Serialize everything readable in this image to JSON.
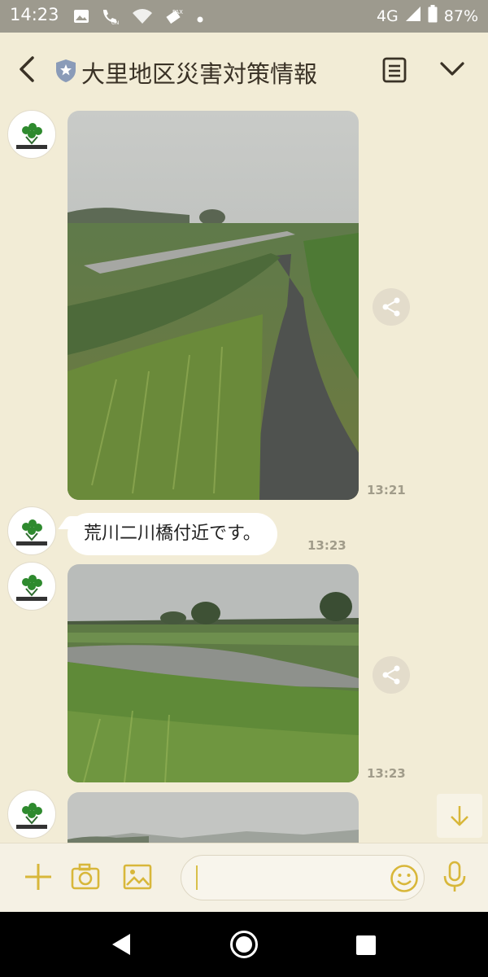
{
  "status_bar": {
    "time": "14:23",
    "network": "4G",
    "battery": "87%",
    "icons": [
      "image-icon",
      "call-volte-icon",
      "wifi-icon",
      "fax-icon",
      "dot-icon",
      "signal-icon",
      "battery-icon"
    ]
  },
  "header": {
    "title": "大里地区災害対策情報",
    "icons": [
      "back-arrow-icon",
      "official-shield-icon",
      "notes-menu-icon",
      "chevron-down-icon"
    ]
  },
  "messages": [
    {
      "type": "image",
      "time": "13:21",
      "scene": "rain-soaked embankment path beside river"
    },
    {
      "type": "text",
      "text": "荒川二川橋付近です。",
      "time": "13:23"
    },
    {
      "type": "image",
      "time": "13:23",
      "scene": "swollen river with grassy banks and trees"
    },
    {
      "type": "image",
      "time": "",
      "scene": "overcast sky with distant hills (partially visible)"
    }
  ],
  "input": {
    "placeholder": "",
    "icons": [
      "plus-icon",
      "camera-icon",
      "gallery-icon",
      "emoji-icon",
      "microphone-icon"
    ]
  },
  "colors": {
    "background": "#f2ecd6",
    "accent": "#d8b73a",
    "status_bar": "#9d9a8e",
    "timestamp": "#a19c8a"
  }
}
